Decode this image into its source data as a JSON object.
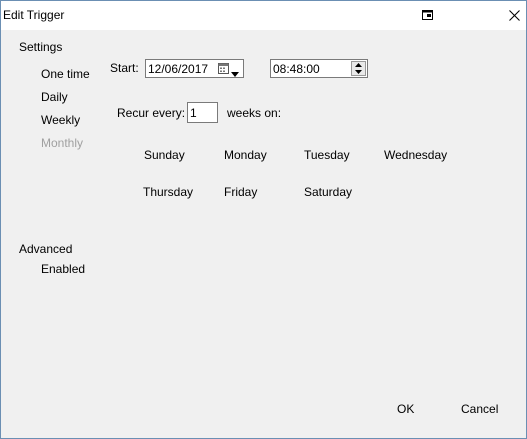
{
  "window": {
    "title": "Edit Trigger"
  },
  "settings": {
    "heading": "Settings",
    "options": [
      "One time",
      "Daily",
      "Weekly",
      "Monthly"
    ]
  },
  "start": {
    "label": "Start:",
    "date": "12/06/2017",
    "time": "08:48:00"
  },
  "recur": {
    "label": "Recur every:",
    "value": "1",
    "suffix": "weeks on:"
  },
  "days": [
    "Sunday",
    "Monday",
    "Tuesday",
    "Wednesday",
    "Thursday",
    "Friday",
    "Saturday"
  ],
  "advanced": {
    "heading": "Advanced",
    "enabled_label": "Enabled"
  },
  "buttons": {
    "ok": "OK",
    "cancel": "Cancel"
  }
}
